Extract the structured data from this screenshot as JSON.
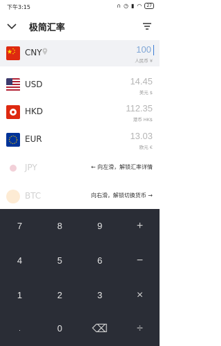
{
  "status_bar": {
    "time": "下午3:15",
    "battery": "27"
  },
  "header": {
    "title": "极简汇率"
  },
  "rows": [
    {
      "code": "CNY",
      "amount": "100",
      "unit": "人民币 ¥",
      "flag": "cn-flag-icon",
      "active": true
    },
    {
      "code": "USD",
      "amount": "14.45",
      "unit": "美元 $",
      "flag": "us-flag-icon"
    },
    {
      "code": "HKD",
      "amount": "112.35",
      "unit": "港币 HK$",
      "flag": "hk-flag-icon"
    },
    {
      "code": "EUR",
      "amount": "13.03",
      "unit": "欧元 €",
      "flag": "eu-flag-icon"
    }
  ],
  "hints": [
    {
      "code": "JPY",
      "text": "← 向左滑，解锁汇率详情",
      "flag": "jp-flag-icon"
    },
    {
      "code": "BTC",
      "text": "向右滑，解锁切换货币 →",
      "flag": "btc-icon"
    }
  ],
  "keypad": {
    "row1": [
      "7",
      "8",
      "9",
      "+"
    ],
    "row2": [
      "4",
      "5",
      "6",
      "−"
    ],
    "row3": [
      "1",
      "2",
      "3",
      "×"
    ],
    "row4": [
      ".",
      "0",
      "⌫",
      "÷"
    ]
  },
  "colors": {
    "keypad_bg": "#2a2d36",
    "active_row_bg": "#f1f2f5",
    "cursor": "#3a7bd5"
  }
}
